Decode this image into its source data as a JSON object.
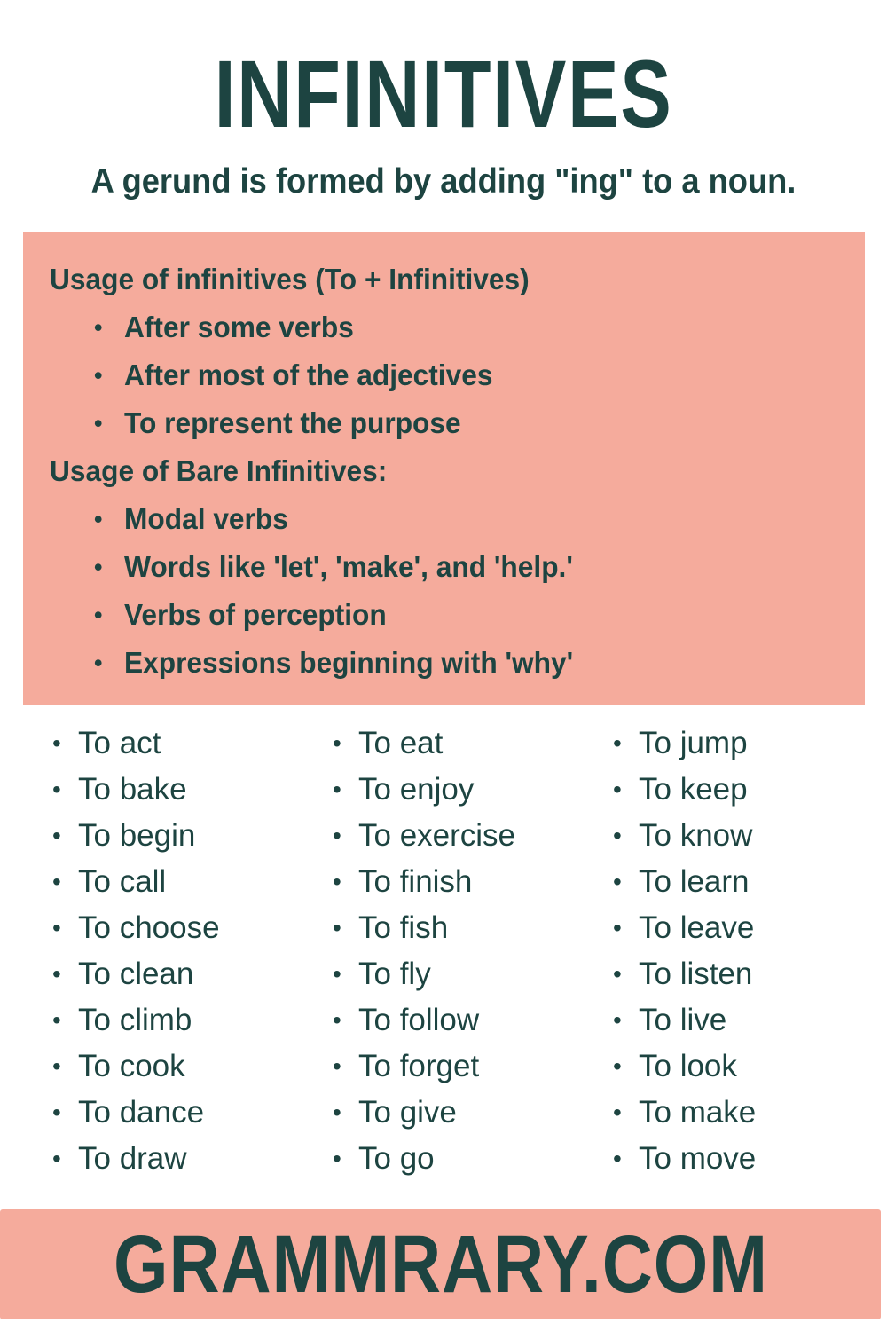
{
  "colors": {
    "accent_pink": "#F5AB9C",
    "dark_teal": "#1D4441",
    "background": "#FFFFFF"
  },
  "header": {
    "title": "INFINITIVES",
    "subtitle": "A gerund is formed by adding \"ing\" to a noun."
  },
  "usage_panel": {
    "heading_1": "Usage of infinitives (To + Infinitives)",
    "list_1": [
      "After some verbs",
      "After most of the adjectives",
      "To represent the purpose"
    ],
    "heading_2": "Usage of Bare Infinitives:",
    "list_2": [
      "Modal verbs",
      "Words like 'let', 'make', and 'help.'",
      "Verbs of perception",
      "Expressions beginning with 'why'"
    ]
  },
  "infinitive_columns": [
    {
      "items": [
        "To act",
        "To bake",
        "To begin",
        "To call",
        "To choose",
        "To clean",
        "To climb",
        "To cook",
        "To dance",
        "To draw"
      ]
    },
    {
      "items": [
        "To eat",
        "To enjoy",
        "To exercise",
        "To finish",
        "To fish",
        "To fly",
        "To follow",
        "To forget",
        "To give",
        "To go"
      ]
    },
    {
      "items": [
        "To jump",
        "To keep",
        "To know",
        "To learn",
        "To leave",
        "To listen",
        "To live",
        "To look",
        "To make",
        "To move"
      ]
    }
  ],
  "footer": {
    "brand": "GRAMMRARY.COM"
  }
}
